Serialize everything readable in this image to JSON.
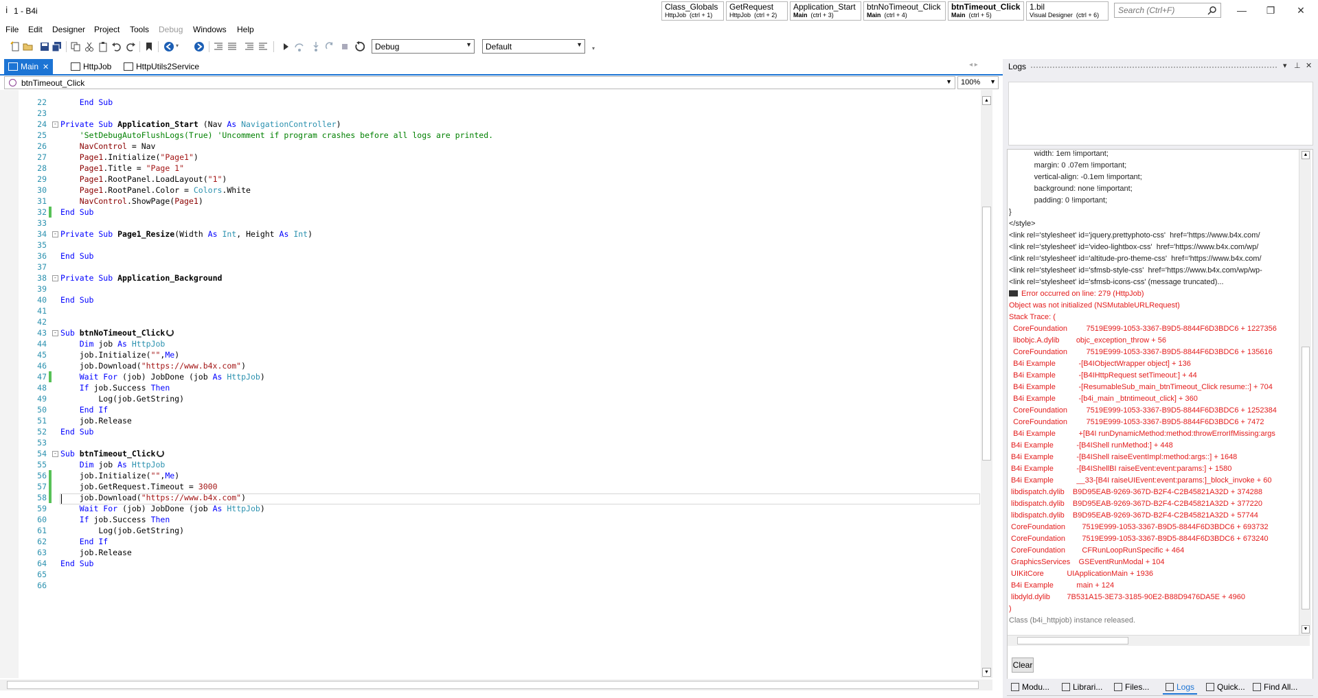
{
  "window": {
    "title": "1 - B4i"
  },
  "nav_tabs": [
    {
      "name": "Class_Globals",
      "sub": "HttpJob",
      "shortcut": "(ctrl + 1)",
      "bold": false,
      "sub_bold": false
    },
    {
      "name": "GetRequest",
      "sub": "HttpJob",
      "shortcut": "(ctrl + 2)",
      "bold": false,
      "sub_bold": false
    },
    {
      "name": "Application_Start",
      "sub": "Main",
      "shortcut": "(ctrl + 3)",
      "bold": false,
      "sub_bold": true
    },
    {
      "name": "btnNoTimeout_Click",
      "sub": "Main",
      "shortcut": "(ctrl + 4)",
      "bold": false,
      "sub_bold": true
    },
    {
      "name": "btnTimeout_Click",
      "sub": "Main",
      "shortcut": "(ctrl + 5)",
      "bold": true,
      "sub_bold": true
    },
    {
      "name": "1.bil",
      "sub": "Visual Designer",
      "shortcut": "(ctrl + 6)",
      "bold": false,
      "sub_bold": false
    }
  ],
  "search": {
    "placeholder": "Search (Ctrl+F)"
  },
  "menu": [
    "File",
    "Edit",
    "Designer",
    "Project",
    "Tools",
    "Debug",
    "Windows",
    "Help"
  ],
  "toolbar": {
    "build_config": "Debug",
    "device": "Default"
  },
  "doc_tabs": [
    {
      "label": "Main",
      "active": true
    },
    {
      "label": "HttpJob",
      "active": false
    },
    {
      "label": "HttpUtils2Service",
      "active": false
    }
  ],
  "editor": {
    "method_selector": "btnTimeout_Click",
    "zoom": "100%",
    "lines": [
      {
        "n": "22",
        "fold": "",
        "changed": false,
        "segs": [
          [
            "kw",
            "    End Sub"
          ]
        ]
      },
      {
        "n": "23",
        "fold": "",
        "changed": false,
        "segs": []
      },
      {
        "n": "24",
        "fold": "-",
        "changed": false,
        "segs": [
          [
            "kw",
            "Private Sub "
          ],
          [
            "fn",
            "Application_Start "
          ],
          [
            "co",
            "(Nav "
          ],
          [
            "kw",
            "As "
          ],
          [
            "ty",
            "NavigationController"
          ],
          [
            "co",
            ")"
          ]
        ]
      },
      {
        "n": "25",
        "fold": "",
        "changed": false,
        "segs": [
          [
            "cm",
            "    'SetDebugAutoFlushLogs(True) 'Uncomment if program crashes before all logs are printed."
          ]
        ]
      },
      {
        "n": "26",
        "fold": "",
        "changed": false,
        "segs": [
          [
            "id",
            "    NavControl"
          ],
          [
            "co",
            " = Nav"
          ]
        ]
      },
      {
        "n": "27",
        "fold": "",
        "changed": false,
        "segs": [
          [
            "id",
            "    Page1"
          ],
          [
            "co",
            ".Initialize("
          ],
          [
            "st",
            "\"Page1\""
          ],
          [
            "co",
            ")"
          ]
        ]
      },
      {
        "n": "28",
        "fold": "",
        "changed": false,
        "segs": [
          [
            "id",
            "    Page1"
          ],
          [
            "co",
            ".Title = "
          ],
          [
            "st",
            "\"Page 1\""
          ]
        ]
      },
      {
        "n": "29",
        "fold": "",
        "changed": false,
        "segs": [
          [
            "id",
            "    Page1"
          ],
          [
            "co",
            ".RootPanel.LoadLayout("
          ],
          [
            "st",
            "\"1\""
          ],
          [
            "co",
            ")"
          ]
        ]
      },
      {
        "n": "30",
        "fold": "",
        "changed": false,
        "segs": [
          [
            "id",
            "    Page1"
          ],
          [
            "co",
            ".RootPanel.Color = "
          ],
          [
            "ty",
            "Colors"
          ],
          [
            "co",
            ".White"
          ]
        ]
      },
      {
        "n": "31",
        "fold": "",
        "changed": false,
        "segs": [
          [
            "id",
            "    NavControl"
          ],
          [
            "co",
            ".ShowPage("
          ],
          [
            "id",
            "Page1"
          ],
          [
            "co",
            ")"
          ]
        ]
      },
      {
        "n": "32",
        "fold": "",
        "changed": true,
        "segs": [
          [
            "kw",
            "End Sub"
          ]
        ]
      },
      {
        "n": "33",
        "fold": "",
        "changed": false,
        "segs": []
      },
      {
        "n": "34",
        "fold": "-",
        "changed": false,
        "segs": [
          [
            "kw",
            "Private Sub "
          ],
          [
            "fn",
            "Page1_Resize"
          ],
          [
            "co",
            "(Width "
          ],
          [
            "kw",
            "As "
          ],
          [
            "ty",
            "Int"
          ],
          [
            "co",
            ", Height "
          ],
          [
            "kw",
            "As "
          ],
          [
            "ty",
            "Int"
          ],
          [
            "co",
            ")"
          ]
        ]
      },
      {
        "n": "35",
        "fold": "",
        "changed": false,
        "segs": []
      },
      {
        "n": "36",
        "fold": "",
        "changed": false,
        "segs": [
          [
            "kw",
            "End Sub"
          ]
        ]
      },
      {
        "n": "37",
        "fold": "",
        "changed": false,
        "segs": []
      },
      {
        "n": "38",
        "fold": "-",
        "changed": false,
        "segs": [
          [
            "kw",
            "Private Sub "
          ],
          [
            "fn",
            "Application_Background"
          ]
        ]
      },
      {
        "n": "39",
        "fold": "",
        "changed": false,
        "segs": []
      },
      {
        "n": "40",
        "fold": "",
        "changed": false,
        "segs": [
          [
            "kw",
            "End Sub"
          ]
        ]
      },
      {
        "n": "41",
        "fold": "",
        "changed": false,
        "segs": []
      },
      {
        "n": "42",
        "fold": "",
        "changed": false,
        "segs": []
      },
      {
        "n": "43",
        "fold": "-",
        "changed": false,
        "resumable": true,
        "segs": [
          [
            "kw",
            "Sub "
          ],
          [
            "fn",
            "btnNoTimeout_Click"
          ]
        ]
      },
      {
        "n": "44",
        "fold": "",
        "changed": false,
        "segs": [
          [
            "kw",
            "    Dim "
          ],
          [
            "co",
            "job "
          ],
          [
            "kw",
            "As "
          ],
          [
            "ty",
            "HttpJob"
          ]
        ]
      },
      {
        "n": "45",
        "fold": "",
        "changed": false,
        "segs": [
          [
            "co",
            "    job.Initialize("
          ],
          [
            "st",
            "\"\""
          ],
          [
            "co",
            ","
          ],
          [
            "kw",
            "Me"
          ],
          [
            "co",
            ")"
          ]
        ]
      },
      {
        "n": "46",
        "fold": "",
        "changed": false,
        "segs": [
          [
            "co",
            "    job.Download("
          ],
          [
            "st",
            "\"https://www.b4x.com\""
          ],
          [
            "co",
            ")"
          ]
        ]
      },
      {
        "n": "47",
        "fold": "",
        "changed": true,
        "segs": [
          [
            "kw",
            "    Wait For "
          ],
          [
            "co",
            "(job) JobDone (job "
          ],
          [
            "kw",
            "As "
          ],
          [
            "ty",
            "HttpJob"
          ],
          [
            "co",
            ")"
          ]
        ]
      },
      {
        "n": "48",
        "fold": "",
        "changed": false,
        "segs": [
          [
            "kw",
            "    If "
          ],
          [
            "co",
            "job.Success "
          ],
          [
            "kw",
            "Then"
          ]
        ]
      },
      {
        "n": "49",
        "fold": "",
        "changed": false,
        "segs": [
          [
            "co",
            "        Log(job.GetString)"
          ]
        ]
      },
      {
        "n": "50",
        "fold": "",
        "changed": false,
        "segs": [
          [
            "kw",
            "    End If"
          ]
        ]
      },
      {
        "n": "51",
        "fold": "",
        "changed": false,
        "segs": [
          [
            "co",
            "    job.Release"
          ]
        ]
      },
      {
        "n": "52",
        "fold": "",
        "changed": false,
        "segs": [
          [
            "kw",
            "End Sub"
          ]
        ]
      },
      {
        "n": "53",
        "fold": "",
        "changed": false,
        "segs": []
      },
      {
        "n": "54",
        "fold": "-",
        "changed": false,
        "resumable": true,
        "segs": [
          [
            "kw",
            "Sub "
          ],
          [
            "fn",
            "btnTimeout_Click"
          ]
        ]
      },
      {
        "n": "55",
        "fold": "",
        "changed": false,
        "segs": [
          [
            "kw",
            "    Dim "
          ],
          [
            "co",
            "job "
          ],
          [
            "kw",
            "As "
          ],
          [
            "ty",
            "HttpJob"
          ]
        ]
      },
      {
        "n": "56",
        "fold": "",
        "changed": true,
        "segs": [
          [
            "co",
            "    job.Initialize("
          ],
          [
            "st",
            "\"\""
          ],
          [
            "co",
            ","
          ],
          [
            "kw",
            "Me"
          ],
          [
            "co",
            ")"
          ]
        ]
      },
      {
        "n": "57",
        "fold": "",
        "changed": true,
        "segs": [
          [
            "co",
            "    job.GetRequest.Timeout = "
          ],
          [
            "nm",
            "3000"
          ]
        ]
      },
      {
        "n": "58",
        "fold": "",
        "changed": true,
        "segs": [
          [
            "co",
            "    job.Download("
          ],
          [
            "st",
            "\"https://www.b4x.com\""
          ],
          [
            "co",
            ")"
          ]
        ]
      },
      {
        "n": "59",
        "fold": "",
        "changed": false,
        "segs": [
          [
            "kw",
            "    Wait For "
          ],
          [
            "co",
            "(job) JobDone (job "
          ],
          [
            "kw",
            "As "
          ],
          [
            "ty",
            "HttpJob"
          ],
          [
            "co",
            ")"
          ]
        ]
      },
      {
        "n": "60",
        "fold": "",
        "changed": false,
        "segs": [
          [
            "kw",
            "    If "
          ],
          [
            "co",
            "job.Success "
          ],
          [
            "kw",
            "Then"
          ]
        ]
      },
      {
        "n": "61",
        "fold": "",
        "changed": false,
        "segs": [
          [
            "co",
            "        Log(job.GetString)"
          ]
        ]
      },
      {
        "n": "62",
        "fold": "",
        "changed": false,
        "segs": [
          [
            "kw",
            "    End If"
          ]
        ]
      },
      {
        "n": "63",
        "fold": "",
        "changed": false,
        "segs": [
          [
            "co",
            "    job.Release"
          ]
        ]
      },
      {
        "n": "64",
        "fold": "",
        "changed": false,
        "segs": [
          [
            "kw",
            "End Sub"
          ]
        ]
      },
      {
        "n": "65",
        "fold": "",
        "changed": false,
        "segs": []
      },
      {
        "n": "66",
        "fold": "",
        "changed": false,
        "segs": []
      }
    ]
  },
  "logs": {
    "title": "Logs",
    "clear_label": "Clear",
    "lines": [
      {
        "c": "black",
        "t": "            width: 1em !important;"
      },
      {
        "c": "black",
        "t": "            margin: 0 .07em !important;"
      },
      {
        "c": "black",
        "t": "            vertical-align: -0.1em !important;"
      },
      {
        "c": "black",
        "t": "            background: none !important;"
      },
      {
        "c": "black",
        "t": "            padding: 0 !important;"
      },
      {
        "c": "black",
        "t": "}"
      },
      {
        "c": "black",
        "t": "</style>"
      },
      {
        "c": "black",
        "t": "<link rel='stylesheet' id='jquery.prettyphoto-css'  href='https://www.b4x.com/"
      },
      {
        "c": "black",
        "t": "<link rel='stylesheet' id='video-lightbox-css'  href='https://www.b4x.com/wp/"
      },
      {
        "c": "black",
        "t": "<link rel='stylesheet' id='altitude-pro-theme-css'  href='https://www.b4x.com/"
      },
      {
        "c": "black",
        "t": "<link rel='stylesheet' id='sfmsb-style-css'  href='https://www.b4x.com/wp/wp-"
      },
      {
        "c": "black",
        "t": "<link rel='stylesheet' id='sfmsb-icons-css' (message truncated)..."
      },
      {
        "c": "red",
        "icon": true,
        "t": "Error occurred on line: 279 (HttpJob)"
      },
      {
        "c": "red",
        "t": "Object was not initialized (NSMutableURLRequest)"
      },
      {
        "c": "red",
        "t": "Stack Trace: ("
      },
      {
        "c": "red",
        "t": "  CoreFoundation         7519E999-1053-3367-B9D5-8844F6D3BDC6 + 1227356"
      },
      {
        "c": "red",
        "t": "  libobjc.A.dylib        objc_exception_throw + 56"
      },
      {
        "c": "red",
        "t": "  CoreFoundation         7519E999-1053-3367-B9D5-8844F6D3BDC6 + 135616"
      },
      {
        "c": "red",
        "t": "  B4i Example           -[B4IObjectWrapper object] + 136"
      },
      {
        "c": "red",
        "t": "  B4i Example           -[B4IHttpRequest setTimeout:] + 44"
      },
      {
        "c": "red",
        "t": "  B4i Example           -[ResumableSub_main_btnTimeout_Click resume::] + 704"
      },
      {
        "c": "red",
        "t": "  B4i Example           -[b4i_main _btntimeout_click] + 360"
      },
      {
        "c": "red",
        "t": "  CoreFoundation         7519E999-1053-3367-B9D5-8844F6D3BDC6 + 1252384"
      },
      {
        "c": "red",
        "t": "  CoreFoundation         7519E999-1053-3367-B9D5-8844F6D3BDC6 + 7472"
      },
      {
        "c": "red",
        "t": "  B4i Example           +[B4I runDynamicMethod:method:throwErrorIfMissing:args"
      },
      {
        "c": "red",
        "t": " B4i Example           -[B4IShell runMethod:] + 448"
      },
      {
        "c": "red",
        "t": " B4i Example           -[B4IShell raiseEventImpl:method:args::] + 1648"
      },
      {
        "c": "red",
        "t": " B4i Example           -[B4IShellBI raiseEvent:event:params:] + 1580"
      },
      {
        "c": "red",
        "t": " B4i Example           __33-[B4I raiseUIEvent:event:params:]_block_invoke + 60"
      },
      {
        "c": "red",
        "t": " libdispatch.dylib    B9D95EAB-9269-367D-B2F4-C2B45821A32D + 374288"
      },
      {
        "c": "red",
        "t": " libdispatch.dylib    B9D95EAB-9269-367D-B2F4-C2B45821A32D + 377220"
      },
      {
        "c": "red",
        "t": " libdispatch.dylib    B9D95EAB-9269-367D-B2F4-C2B45821A32D + 57744"
      },
      {
        "c": "red",
        "t": " CoreFoundation        7519E999-1053-3367-B9D5-8844F6D3BDC6 + 693732"
      },
      {
        "c": "red",
        "t": " CoreFoundation        7519E999-1053-3367-B9D5-8844F6D3BDC6 + 673240"
      },
      {
        "c": "red",
        "t": " CoreFoundation        CFRunLoopRunSpecific + 464"
      },
      {
        "c": "red",
        "t": " GraphicsServices    GSEventRunModal + 104"
      },
      {
        "c": "red",
        "t": " UIKitCore           UIApplicationMain + 1936"
      },
      {
        "c": "red",
        "t": " B4i Example           main + 124"
      },
      {
        "c": "red",
        "t": " libdyld.dylib        7B531A15-3E73-3185-90E2-B88D9476DA5E + 4960"
      },
      {
        "c": "red",
        "t": ")"
      },
      {
        "c": "gray",
        "t": "Class (b4i_httpjob) instance released."
      }
    ]
  },
  "panel_tabs": [
    {
      "label": "Modu...",
      "active": false
    },
    {
      "label": "Librari...",
      "active": false
    },
    {
      "label": "Files...",
      "active": false
    },
    {
      "label": "Logs",
      "active": true
    },
    {
      "label": "Quick...",
      "active": false
    },
    {
      "label": "Find All...",
      "active": false
    }
  ]
}
